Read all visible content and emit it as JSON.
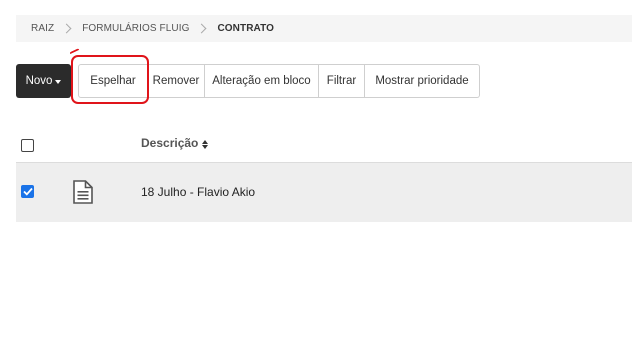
{
  "breadcrumb": {
    "items": [
      "RAIZ",
      "FORMULÁRIOS FLUIG",
      "CONTRATO"
    ]
  },
  "toolbar": {
    "novo_label": "Novo",
    "buttons": [
      "Espelhar",
      "Remover",
      "Alteração em bloco",
      "Filtrar",
      "Mostrar prioridade"
    ]
  },
  "table": {
    "header": {
      "description_label": "Descrição"
    },
    "rows": [
      {
        "description": "18 Julho - Flavio Akio",
        "checked": true
      }
    ]
  },
  "colors": {
    "novo_bg": "#2b2b2b",
    "row_selected_bg": "#eeeeee",
    "checkbox_accent": "#1a73e8",
    "annotation_red": "#e0141a"
  },
  "icons": {
    "breadcrumb_separator": "chevron-right-icon",
    "novo_caret": "caret-down-icon",
    "sort": "sort-icon",
    "row_type": "document-icon"
  }
}
